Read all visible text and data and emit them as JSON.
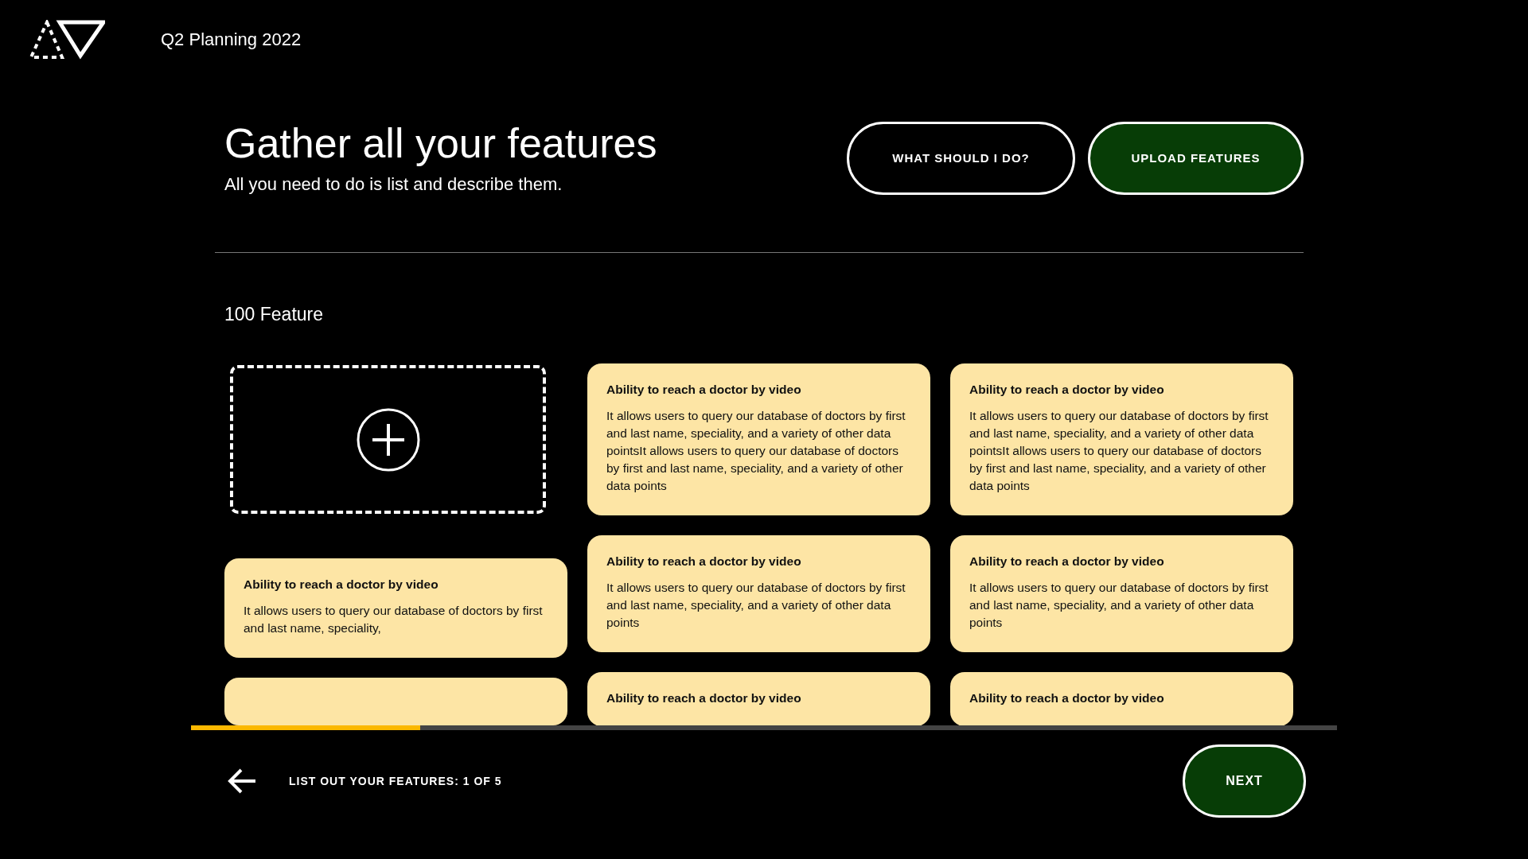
{
  "header": {
    "title": "Q2 Planning 2022"
  },
  "hero": {
    "heading": "Gather all your features",
    "subheading": "All you need to do is list and describe them.",
    "buttons": [
      {
        "label": "WHAT SHOULD I DO?",
        "kind": "outline"
      },
      {
        "label": "UPLOAD FEATURES",
        "kind": "filled"
      }
    ]
  },
  "section_title": "100 Feature",
  "columns": [
    [
      {
        "kind": "add"
      },
      {
        "kind": "feature",
        "title": "Ability to reach a doctor by video",
        "body": "It allows users to query our database of doctors by first and last name, speciality,"
      },
      {
        "kind": "feature"
      }
    ],
    [
      {
        "kind": "feature",
        "title": "Ability to reach a doctor by video",
        "body": "It allows users to query our database of doctors by first and last name, speciality, and a variety of other data pointsIt allows users to query our database of doctors by first and last name, speciality, and a variety of other data points"
      },
      {
        "kind": "feature",
        "title": "Ability to reach a doctor by video",
        "body": "It allows users to query our database of doctors by first and last name, speciality, and a variety of other data points"
      },
      {
        "kind": "feature",
        "title": "Ability to reach a doctor by video"
      }
    ],
    [
      {
        "kind": "feature",
        "title": "Ability to reach a doctor by video",
        "body": "It allows users to query our database of doctors by first and last name, speciality, and a variety of other data pointsIt allows users to query our database of doctors by first and last name, speciality, and a variety of other data points"
      },
      {
        "kind": "feature",
        "title": "Ability to reach a doctor by video",
        "body": "It allows users to query our database of doctors by first and last name, speciality, and a variety of other data points"
      },
      {
        "kind": "feature",
        "title": "Ability to reach a doctor by video"
      }
    ]
  ],
  "progress": {
    "level": 0.2
  },
  "footer": {
    "step": "LIST OUT YOUR FEATURES: 1 OF 5",
    "next": "NEXT"
  }
}
